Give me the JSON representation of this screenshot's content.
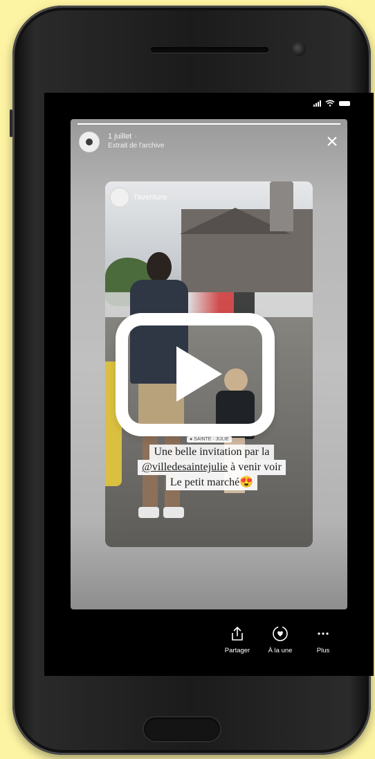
{
  "story": {
    "date": "1 juillet",
    "time": "·",
    "subtitle": "Extrait de l'archive",
    "progress_fraction": 1.0,
    "account_tag": "l'aventure"
  },
  "caption": {
    "line1": "Une belle invitation par la",
    "mention": "@villedesaintejulie",
    "line2_rest": " à venir voir",
    "line3": "Le petit marché😍",
    "sticker": "● SAINTE · JULIE"
  },
  "actions": [
    {
      "label": "Partager",
      "icon": "share-icon"
    },
    {
      "label": "À la une",
      "icon": "highlight-heart-icon"
    },
    {
      "label": "Plus",
      "icon": "more-icon"
    }
  ],
  "colors": {
    "background": "#fdf4a3",
    "phone_body": "#1b1b1b",
    "accent": "#ffffff"
  }
}
